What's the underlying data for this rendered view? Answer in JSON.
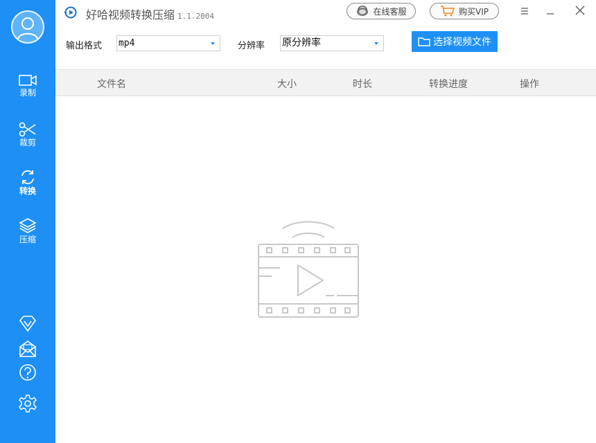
{
  "app": {
    "title": "好哈视频转换压缩",
    "version": "1.1.2004"
  },
  "header": {
    "support_label": "在线客服",
    "vip_label": "购买VIP"
  },
  "sidebar": {
    "items": [
      {
        "label": "录制",
        "icon": "camera-icon"
      },
      {
        "label": "裁剪",
        "icon": "scissors-icon"
      },
      {
        "label": "转换",
        "icon": "convert-icon"
      },
      {
        "label": "压缩",
        "icon": "layers-icon"
      }
    ],
    "active": "转换",
    "bottom_icons": [
      "vip-diamond-icon",
      "mail-icon",
      "help-icon",
      "settings-icon"
    ]
  },
  "toolbar": {
    "format_label": "输出格式",
    "format_value": "mp4",
    "resolution_label": "分辨率",
    "resolution_value": "原分辨率",
    "choose_button": "选择视频文件"
  },
  "table": {
    "columns": [
      "文件名",
      "大小",
      "时长",
      "转换进度",
      "操作"
    ],
    "rows": []
  },
  "colors": {
    "accent": "#1e90f5",
    "header_bg": "#f2f2f2"
  }
}
